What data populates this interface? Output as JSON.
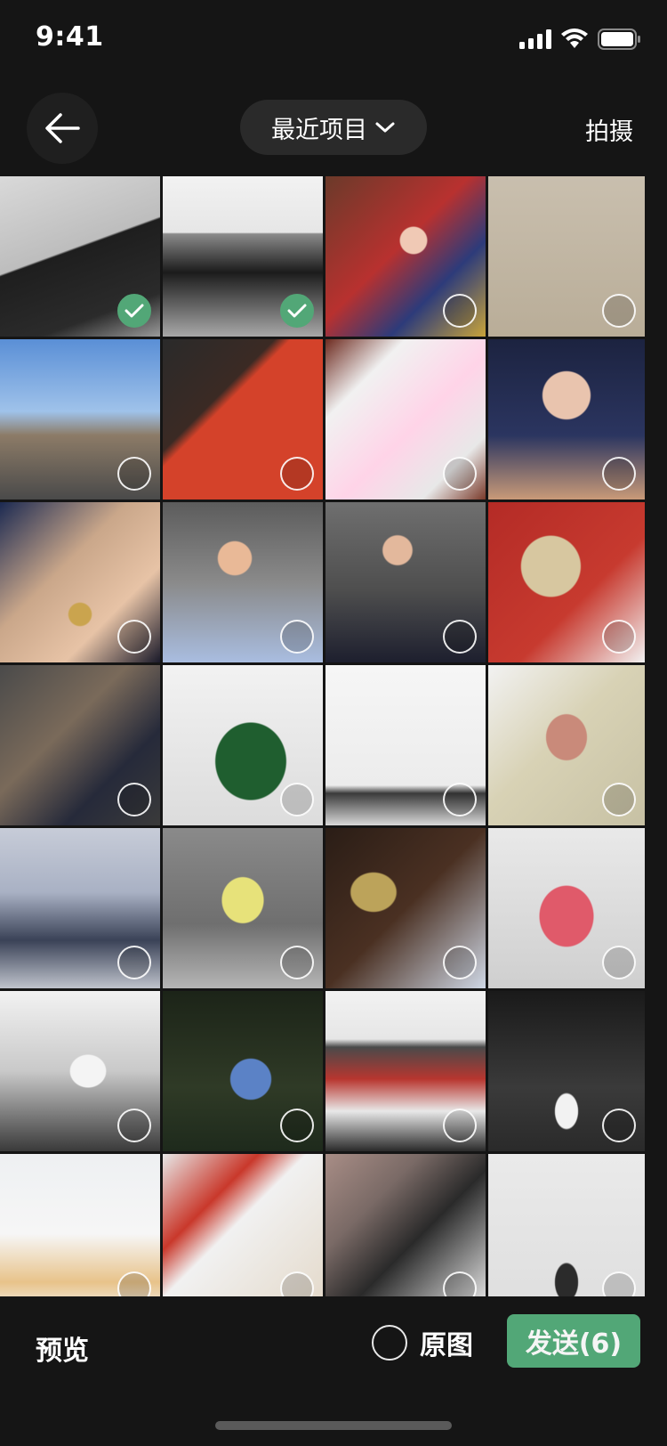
{
  "status": {
    "time": "9:41"
  },
  "nav": {
    "back_icon": "arrow-left-icon",
    "album_title": "最近项目",
    "camera_label": "拍摄"
  },
  "photos": [
    {
      "selected": true,
      "name": "photo-black-coat"
    },
    {
      "selected": true,
      "name": "photo-black-boots"
    },
    {
      "selected": false,
      "name": "photo-girl-red-room"
    },
    {
      "selected": false,
      "name": "photo-hibi-box"
    },
    {
      "selected": false,
      "name": "photo-church-balloons"
    },
    {
      "selected": false,
      "name": "photo-sofit-gym"
    },
    {
      "selected": false,
      "name": "photo-stickers-phone"
    },
    {
      "selected": false,
      "name": "photo-girl-beret"
    },
    {
      "selected": false,
      "name": "photo-necklace"
    },
    {
      "selected": false,
      "name": "photo-girl-blue-shirt"
    },
    {
      "selected": false,
      "name": "photo-girl-drink"
    },
    {
      "selected": false,
      "name": "photo-mirror-red-wall"
    },
    {
      "selected": false,
      "name": "photo-girl-mask"
    },
    {
      "selected": false,
      "name": "photo-green-bottle"
    },
    {
      "selected": false,
      "name": "photo-murua-store"
    },
    {
      "selected": false,
      "name": "photo-tiger-leaf-eye"
    },
    {
      "selected": false,
      "name": "photo-street-orange-bag"
    },
    {
      "selected": false,
      "name": "photo-yellow-top"
    },
    {
      "selected": false,
      "name": "photo-piano-mirror"
    },
    {
      "selected": false,
      "name": "photo-pink-candles"
    },
    {
      "selected": false,
      "name": "photo-gym-treadmill"
    },
    {
      "selected": false,
      "name": "photo-girl-park-night"
    },
    {
      "selected": false,
      "name": "photo-book-stack"
    },
    {
      "selected": false,
      "name": "photo-night-street"
    },
    {
      "selected": false,
      "name": "photo-white-cafe"
    },
    {
      "selected": false,
      "name": "photo-red-chairs"
    },
    {
      "selected": false,
      "name": "photo-black-box"
    },
    {
      "selected": false,
      "name": "photo-studio-pose"
    }
  ],
  "bottom": {
    "preview_label": "预览",
    "original_label": "原图",
    "send_label": "发送(6)"
  },
  "colors": {
    "accent": "#52a777",
    "background": "#151515"
  }
}
